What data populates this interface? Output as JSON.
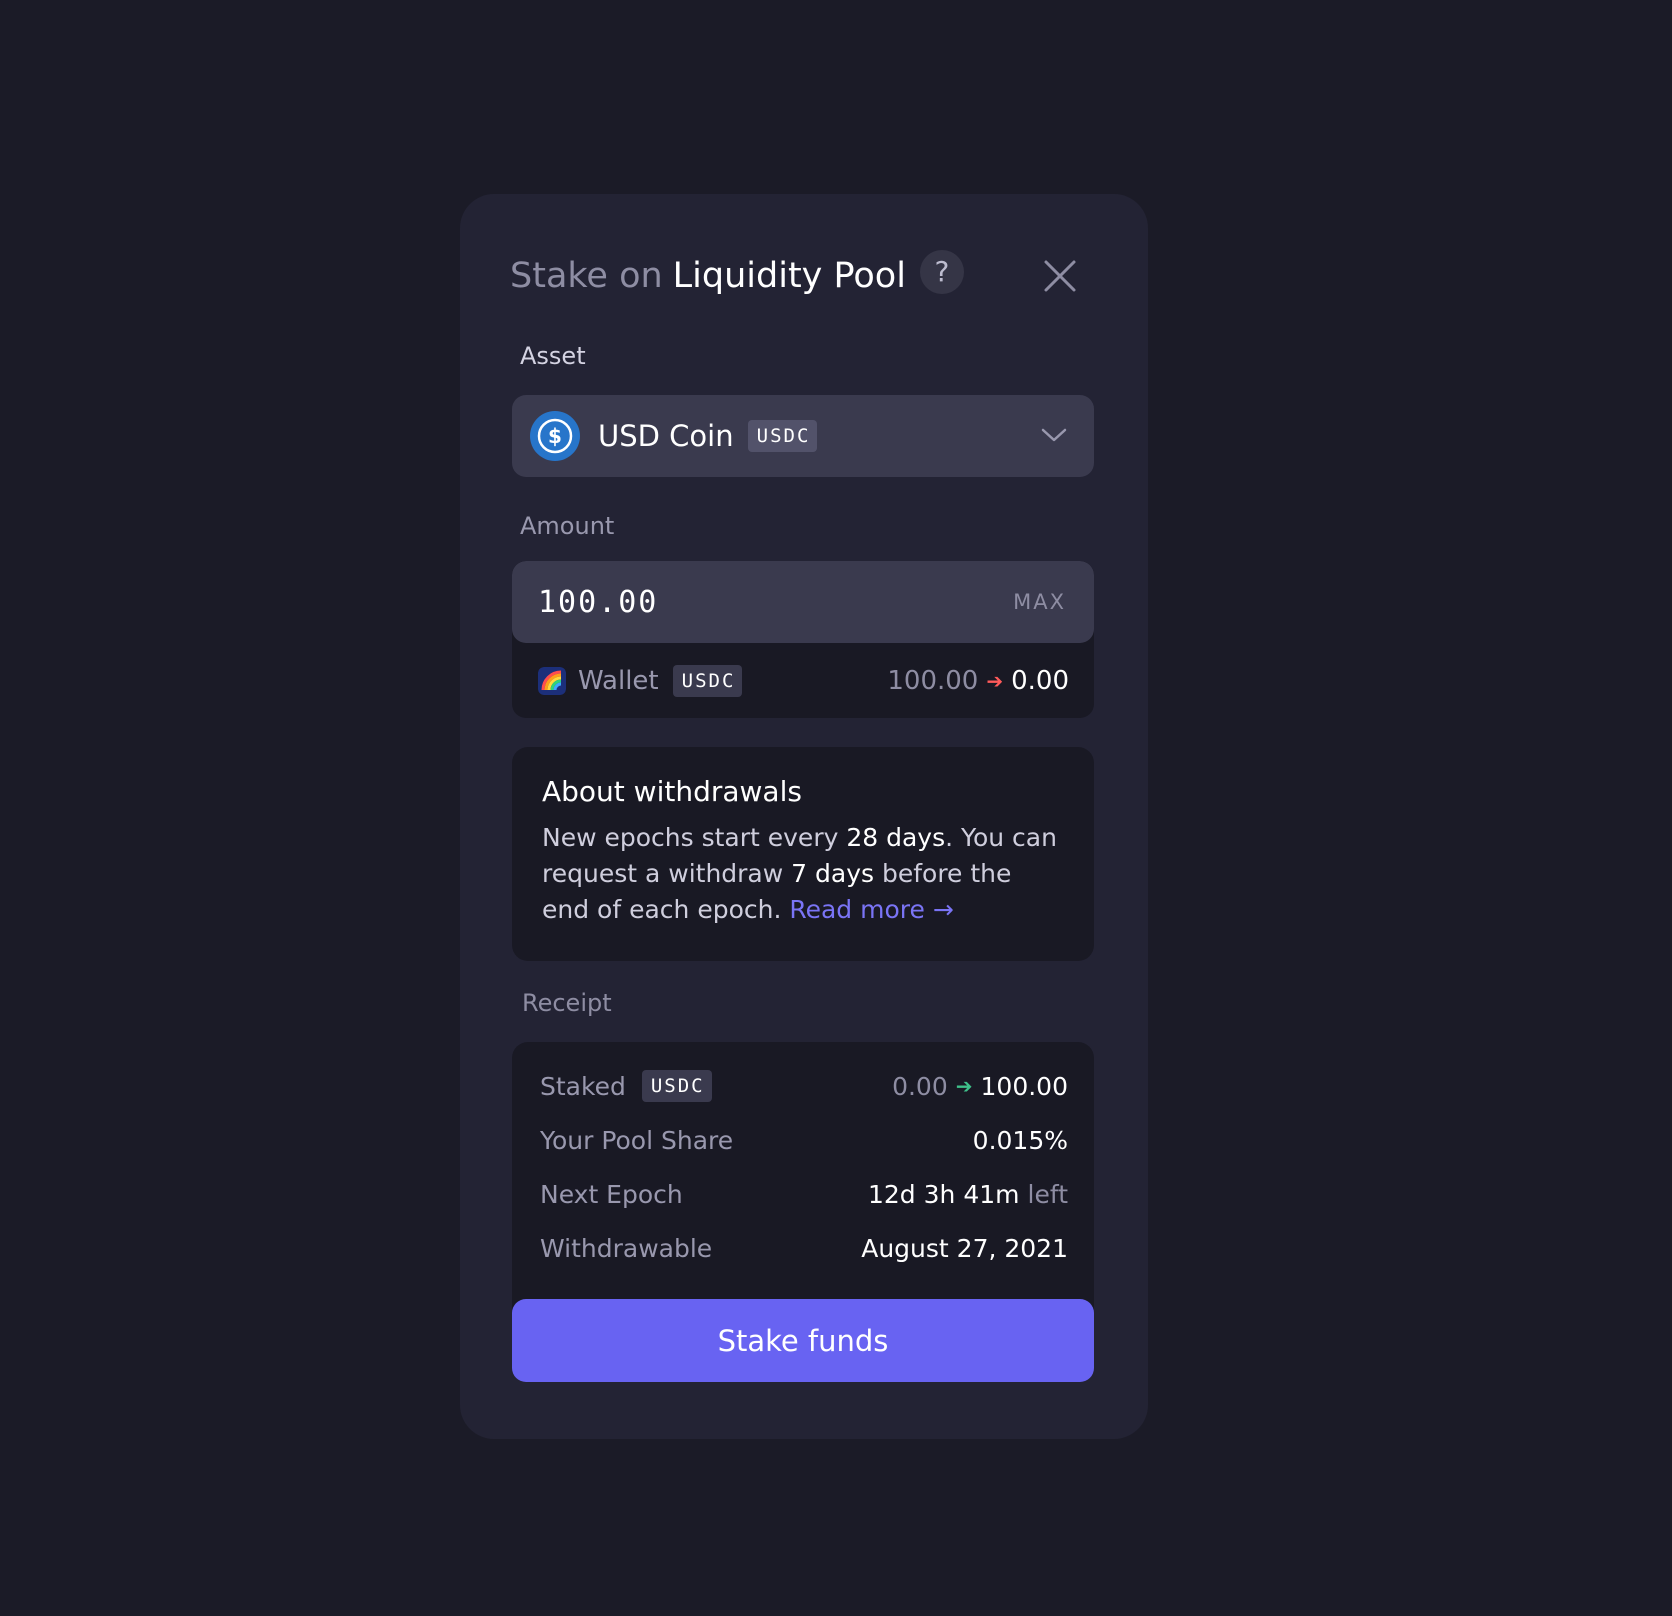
{
  "modal": {
    "title_prefix": "Stake on",
    "title_main": "Liquidity Pool",
    "help_label": "?"
  },
  "asset": {
    "label": "Asset",
    "name": "USD Coin",
    "ticker": "USDC",
    "icon": "usdc-coin-icon",
    "icon_color": "#2775ca"
  },
  "amount": {
    "label": "Amount",
    "value": "100.00",
    "max_label": "MAX",
    "wallet": {
      "label": "Wallet",
      "ticker": "USDC",
      "from": "100.00",
      "to": "0.00",
      "icon": "rainbow-wallet-icon"
    }
  },
  "about": {
    "title": "About withdrawals",
    "text_1": "New epochs start every ",
    "epoch_days": "28 days",
    "text_2": ". You can request a withdraw ",
    "request_days": "7 days",
    "text_3": " before the end of each epoch. ",
    "read_more": "Read more →"
  },
  "receipt": {
    "label": "Receipt",
    "staked": {
      "label": "Staked",
      "ticker": "USDC",
      "from": "0.00",
      "to": "100.00"
    },
    "pool_share": {
      "label": "Your Pool Share",
      "value": "0.015%"
    },
    "next_epoch": {
      "label": "Next Epoch",
      "value": "12d 3h 41m",
      "suffix": "left"
    },
    "withdrawable": {
      "label": "Withdrawable",
      "value": "August 27, 2021"
    }
  },
  "actions": {
    "stake_label": "Stake funds"
  },
  "colors": {
    "background": "#1b1b27",
    "modal": "#232334",
    "accent": "#6863f2",
    "link": "#7a74f5",
    "decrease_arrow": "#ff5a5a",
    "increase_arrow": "#3ec08a"
  }
}
